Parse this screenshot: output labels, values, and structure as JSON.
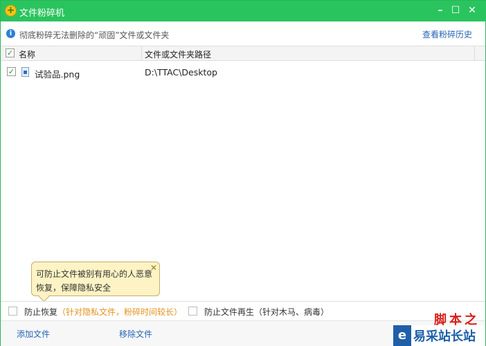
{
  "window": {
    "title": "文件粉碎机",
    "minimize": "–",
    "maximize": "☐",
    "close": "✕"
  },
  "info": {
    "text": "彻底粉碎无法删除的“顽固”文件或文件夹",
    "history_link": "查看粉碎历史"
  },
  "table": {
    "columns": [
      "名称",
      "文件或文件夹路径"
    ],
    "rows": [
      {
        "name": "试验品.png",
        "path": "D:\\TTAC\\Desktop",
        "checked": true
      }
    ]
  },
  "tooltip": {
    "text": "可防止文件被别有用心的人恶意恢复，保障隐私安全",
    "close": "✕"
  },
  "options": {
    "prevent_recovery": "防止恢复",
    "prevent_recovery_note": "（针对隐私文件，粉碎时间较长）",
    "prevent_regen": "防止文件再生（针对木马、病毒）"
  },
  "footer": {
    "add": "添加文件",
    "remove": "移除文件"
  },
  "watermark": {
    "top": "脚本之家",
    "brand": "易采站长站"
  },
  "colors": {
    "titlebar": "#2ac45e",
    "link": "#2765b5",
    "note": "#e6921c"
  }
}
